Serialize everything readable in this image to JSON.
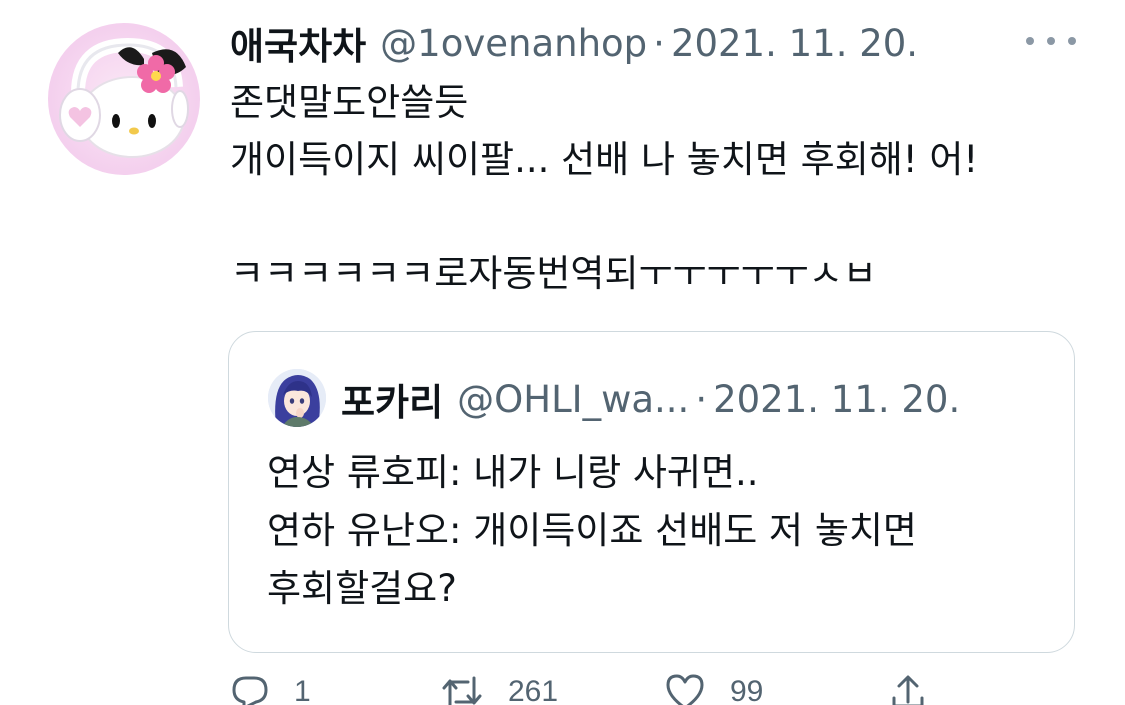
{
  "tweet": {
    "author": {
      "display_name": "애국차차",
      "handle": "@1ovenanhop",
      "separator": "·",
      "date": "2021. 11. 20."
    },
    "text": "존댓말도안쓸듯\n개이득이지 씨이팔... 선배 나 놓치면 후회해! 어!\n\nㅋㅋㅋㅋㅋㅋ로자동번역되ㅜㅜㅜㅜㅜㅅㅂ",
    "quoted": {
      "display_name": "포카리",
      "handle": "@OHLI_wa...",
      "separator": "·",
      "date": "2021. 11. 20.",
      "text": "연상 류호피: 내가 니랑 사귀면..\n연하 유난오: 개이득이죠 선배도 저 놓치면\n후회할걸요?"
    },
    "actions": {
      "reply_count": "1",
      "retweet_count": "261",
      "like_count": "99"
    }
  },
  "icons": {
    "more": "more-horizontal-icon",
    "reply": "reply-icon",
    "retweet": "retweet-icon",
    "like": "heart-icon",
    "share": "share-icon"
  },
  "colors": {
    "text_primary": "#0f1419",
    "text_secondary": "#536471",
    "border": "#cfd9de"
  }
}
